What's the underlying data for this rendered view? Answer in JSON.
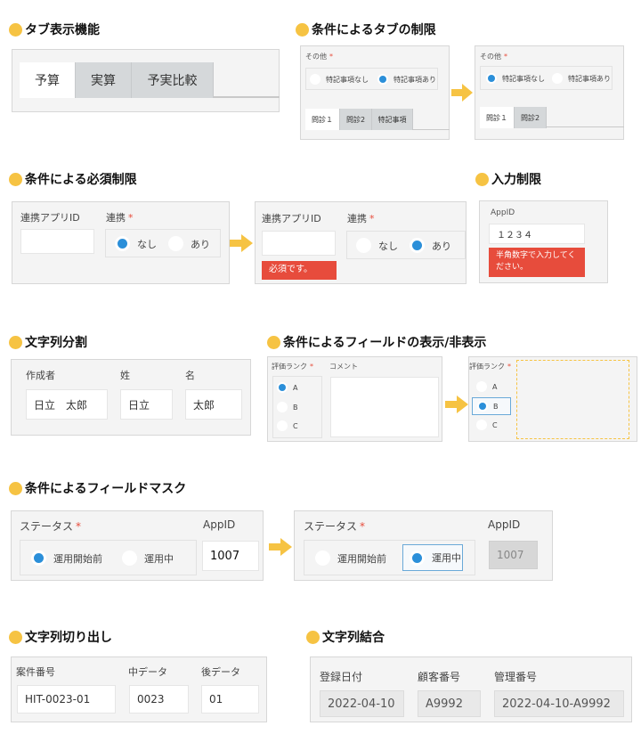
{
  "accent_color": "#f6c343",
  "selected_radio_color": "#2b8fd9",
  "error_color": "#e74c3c",
  "sections": {
    "tab_display": {
      "title": "タブ表示機能",
      "tabs": [
        {
          "label": "予算",
          "active": true
        },
        {
          "label": "実算",
          "active": false
        },
        {
          "label": "予実比較",
          "active": false
        }
      ]
    },
    "conditional_tab": {
      "title": "条件によるタブの制限",
      "before": {
        "field_label": "その他",
        "required_mark": "*",
        "options": [
          {
            "label": "特記事項なし",
            "selected": false
          },
          {
            "label": "特記事項あり",
            "selected": true
          }
        ],
        "tabs": [
          {
            "label": "問診１",
            "active": true
          },
          {
            "label": "問診2",
            "active": false
          },
          {
            "label": "特記事項",
            "active": false
          }
        ]
      },
      "after": {
        "field_label": "その他",
        "required_mark": "*",
        "options": [
          {
            "label": "特記事項なし",
            "selected": true
          },
          {
            "label": "特記事項あり",
            "selected": false
          }
        ],
        "tabs": [
          {
            "label": "問診１",
            "active": true
          },
          {
            "label": "問診2",
            "active": false
          }
        ]
      }
    },
    "conditional_required": {
      "title": "条件による必須制限",
      "before": {
        "id_label": "連携アプリID",
        "id_value": "",
        "link_label": "連携",
        "required_mark": "*",
        "options": [
          {
            "label": "なし",
            "selected": true
          },
          {
            "label": "あり",
            "selected": false
          }
        ]
      },
      "after": {
        "id_label": "連携アプリID",
        "id_value": "",
        "error": "必須です。",
        "link_label": "連携",
        "required_mark": "*",
        "options": [
          {
            "label": "なし",
            "selected": false
          },
          {
            "label": "あり",
            "selected": true
          }
        ]
      }
    },
    "input_restriction": {
      "title": "入力制限",
      "label": "AppID",
      "value": "１２３４",
      "error": "半角数字で入力してください。"
    },
    "string_split": {
      "title": "文字列分割",
      "fields": [
        {
          "label": "作成者",
          "value": "日立　太郎"
        },
        {
          "label": "姓",
          "value": "日立"
        },
        {
          "label": "名",
          "value": "太郎"
        }
      ]
    },
    "conditional_visibility": {
      "title": "条件によるフィールドの表示/非表示",
      "before": {
        "rank_label": "評価ランク",
        "required_mark": "*",
        "comment_label": "コメント",
        "comment_value": "",
        "options": [
          {
            "label": "A",
            "selected": true
          },
          {
            "label": "B",
            "selected": false
          },
          {
            "label": "C",
            "selected": false
          }
        ]
      },
      "after": {
        "rank_label": "評価ランク",
        "required_mark": "*",
        "options": [
          {
            "label": "A",
            "selected": false
          },
          {
            "label": "B",
            "selected": true
          },
          {
            "label": "C",
            "selected": false
          }
        ]
      }
    },
    "field_mask": {
      "title": "条件によるフィールドマスク",
      "before": {
        "status_label": "ステータス",
        "required_mark": "*",
        "appid_label": "AppID",
        "appid_value": "1007",
        "options": [
          {
            "label": "運用開始前",
            "selected": true
          },
          {
            "label": "運用中",
            "selected": false
          }
        ]
      },
      "after": {
        "status_label": "ステータス",
        "required_mark": "*",
        "appid_label": "AppID",
        "appid_value": "1007",
        "options": [
          {
            "label": "運用開始前",
            "selected": false
          },
          {
            "label": "運用中",
            "selected": true
          }
        ]
      }
    },
    "substring": {
      "title": "文字列切り出し",
      "fields": [
        {
          "label": "案件番号",
          "value": "HIT-0023-01"
        },
        {
          "label": "中データ",
          "value": "0023"
        },
        {
          "label": "後データ",
          "value": "01"
        }
      ]
    },
    "concat": {
      "title": "文字列結合",
      "fields": [
        {
          "label": "登録日付",
          "value": "2022-04-10"
        },
        {
          "label": "顧客番号",
          "value": "A9992"
        },
        {
          "label": "管理番号",
          "value": "2022-04-10-A9992"
        }
      ]
    }
  }
}
